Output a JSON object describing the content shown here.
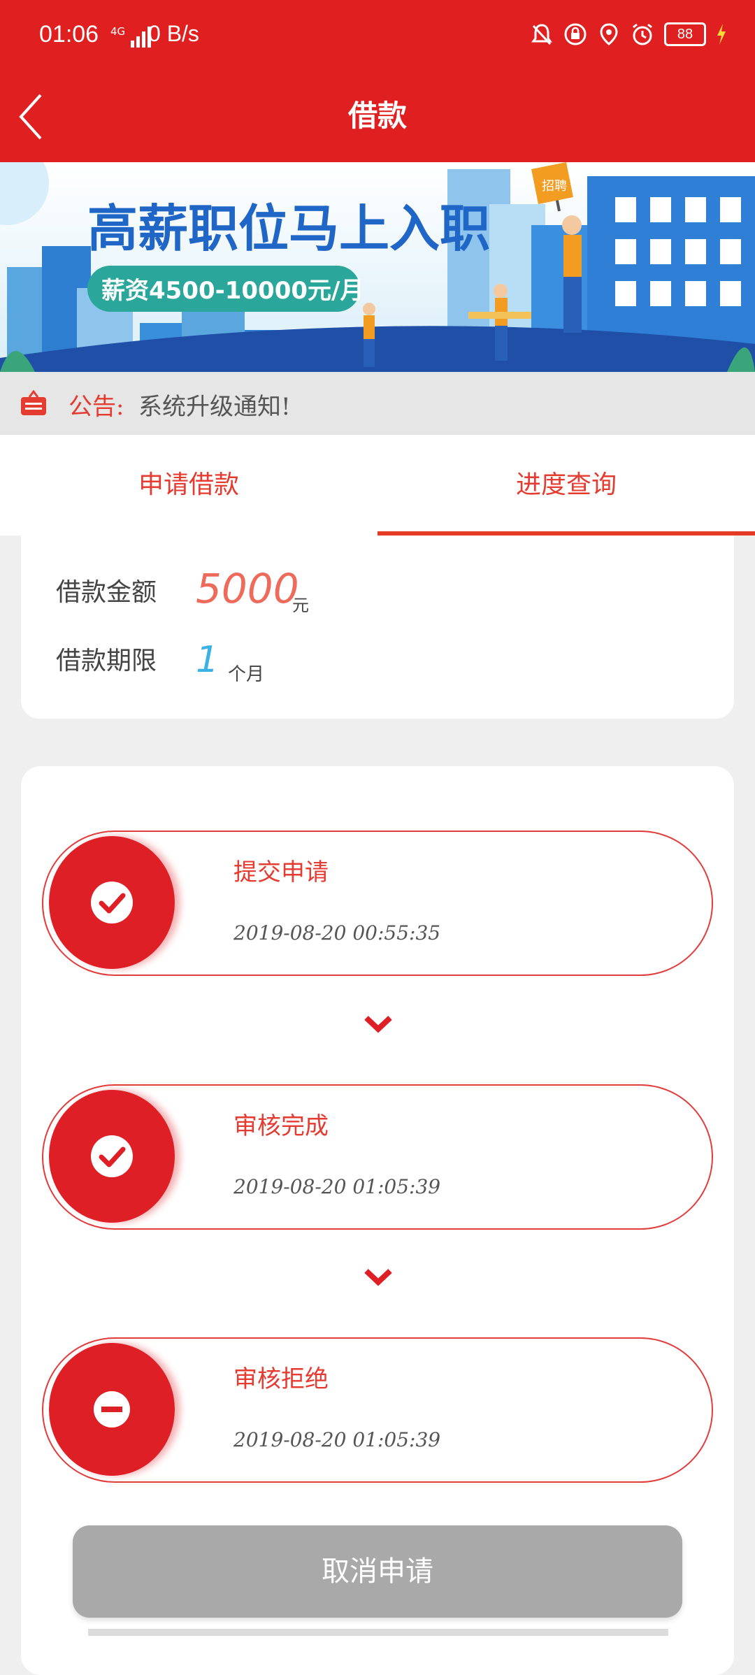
{
  "status_bar": {
    "time": "01:06",
    "network": "4G",
    "speed": "0 B/s",
    "battery": "88",
    "icons": [
      "bell-off-icon",
      "lock-rotation-icon",
      "location-icon",
      "alarm-icon",
      "battery-icon",
      "charging-icon"
    ]
  },
  "header": {
    "title": "借款",
    "back_icon": "chevron-left-icon"
  },
  "banner": {
    "headline": "高薪职位马上入职",
    "subline": "薪资4500-10000元/月",
    "flag_text": "招聘"
  },
  "notice": {
    "label": "公告:",
    "message": "系统升级通知!"
  },
  "tabs": [
    {
      "label": "申请借款",
      "selected": false
    },
    {
      "label": "进度查询",
      "selected": true
    }
  ],
  "loan_info": {
    "amount_label": "借款金额",
    "amount_value": "5000",
    "amount_unit": "元",
    "term_label": "借款期限",
    "term_value": "1",
    "term_unit": "个月"
  },
  "progress": [
    {
      "name": "提交申请",
      "time": "2019-08-20  00:55:35",
      "status": "done",
      "icon": "check-icon"
    },
    {
      "name": "审核完成",
      "time": "2019-08-20  01:05:39",
      "status": "done",
      "icon": "check-icon"
    },
    {
      "name": "审核拒绝",
      "time": "2019-08-20  01:05:39",
      "status": "rejected",
      "icon": "minus-icon"
    }
  ],
  "cancel_button": "取消申请",
  "colors": {
    "brand_red": "#e02020",
    "accent_red": "#e53b30",
    "amount": "#ee6a5a",
    "term": "#3bb1e6",
    "disabled": "#a9a9a9"
  }
}
